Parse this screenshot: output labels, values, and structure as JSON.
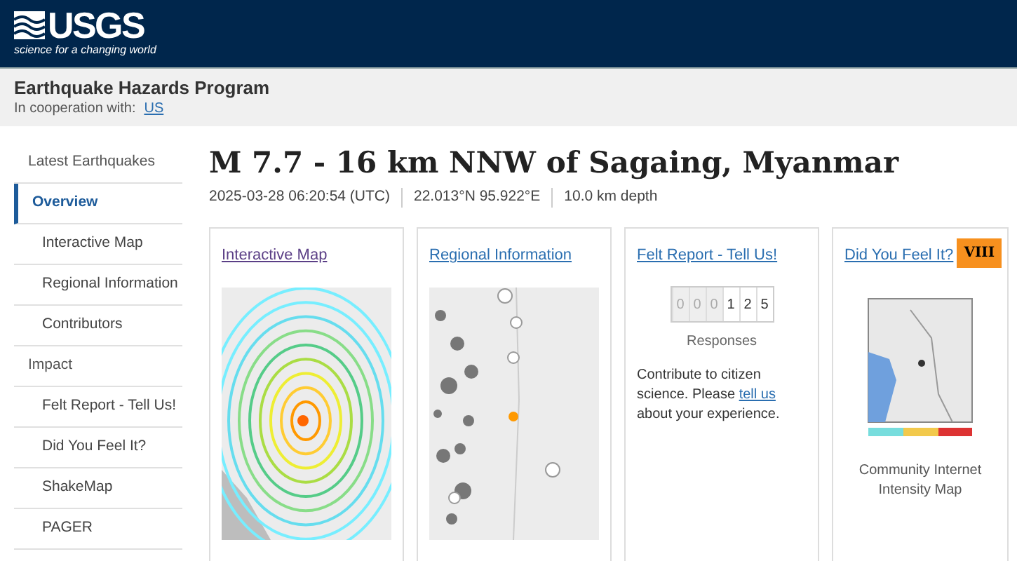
{
  "header": {
    "logo": "USGS",
    "tagline": "science for a changing world"
  },
  "program": {
    "title": "Earthquake Hazards Program",
    "cooperation_label": "In cooperation with:",
    "cooperation_link": "US"
  },
  "sidebar": {
    "items": [
      {
        "label": "Latest Earthquakes",
        "selected": false
      },
      {
        "label": "Overview",
        "selected": true,
        "children": [
          {
            "label": "Interactive Map",
            "selected": false
          },
          {
            "label": "Regional Information",
            "selected": false
          },
          {
            "label": "Contributors",
            "selected": false
          }
        ]
      },
      {
        "label": "Impact",
        "selected": false,
        "children": [
          {
            "label": "Felt Report - Tell Us!",
            "selected": false
          },
          {
            "label": "Did You Feel It?",
            "selected": false
          },
          {
            "label": "ShakeMap",
            "selected": false
          },
          {
            "label": "PAGER",
            "selected": false
          }
        ]
      }
    ]
  },
  "event": {
    "title": "M 7.7 - 16 km NNW of Sagaing, Myanmar",
    "meta": [
      "2025-03-28 06:20:54 (UTC)",
      "22.013°N 95.922°E",
      "10.0 km depth"
    ]
  },
  "cards": [
    {
      "kind": "shakemap",
      "title": "Interactive Map"
    },
    {
      "kind": "regional",
      "title": "Regional Information"
    },
    {
      "kind": "felt",
      "title": "Felt Report - Tell Us!",
      "digits": [
        {
          "text": "0",
          "dim": true
        },
        {
          "text": "0",
          "dim": true
        },
        {
          "text": "0",
          "dim": true
        },
        {
          "text": "1",
          "dim": false
        },
        {
          "text": "2",
          "dim": false
        },
        {
          "text": "5",
          "dim": false
        }
      ],
      "counter_label": "Responses",
      "body": "Contribute to citizen science. Please ",
      "link": "tell us",
      "body_end": " about your experience."
    },
    {
      "kind": "dyfi",
      "title": "Did You Feel It?",
      "badge": "VIII",
      "color": "#f7901e",
      "caption": "Community Internet Intensity Map"
    }
  ]
}
